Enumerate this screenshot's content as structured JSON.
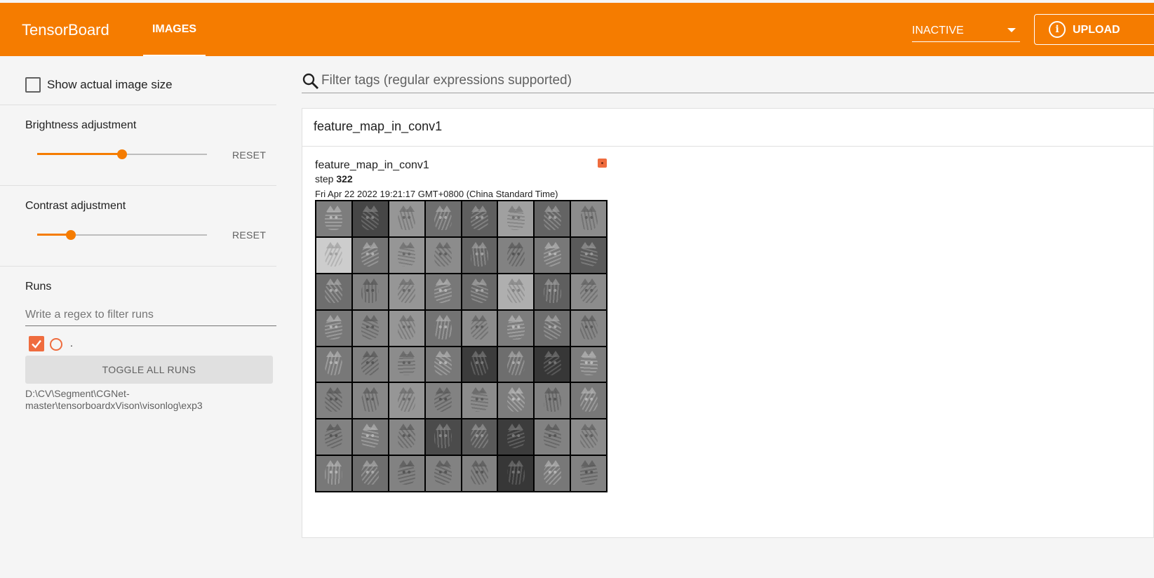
{
  "header": {
    "brand": "TensorBoard",
    "tab_images": "IMAGES",
    "status_select": "INACTIVE",
    "upload_label": "UPLOAD"
  },
  "sidebar": {
    "show_actual_size": {
      "label": "Show actual image size",
      "checked": false
    },
    "brightness": {
      "title": "Brightness adjustment",
      "value": 0.5,
      "reset": "RESET"
    },
    "contrast": {
      "title": "Contrast adjustment",
      "value": 0.2,
      "reset": "RESET"
    },
    "runs": {
      "title": "Runs",
      "filter_placeholder": "Write a regex to filter runs",
      "items": [
        {
          "name": ".",
          "checked": true,
          "color": "#ef6c3e"
        }
      ],
      "toggle_all": "TOGGLE ALL RUNS",
      "logdir": "D:\\CV\\Segment\\CGNet-master\\tensorboardxVison\\visonlog\\exp3"
    }
  },
  "main": {
    "filter_placeholder": "Filter tags (regular expressions supported)",
    "card": {
      "title": "feature_map_in_conv1",
      "image": {
        "tag": "feature_map_in_conv1",
        "step_label": "step",
        "step": "322",
        "timestamp": "Fri Apr 22 2022 19:21:17 GMT+0800 (China Standard Time)",
        "grid_rows": 8,
        "grid_cols": 8
      }
    }
  },
  "colors": {
    "accent": "#f57c00",
    "run_color": "#ef6c3e"
  }
}
